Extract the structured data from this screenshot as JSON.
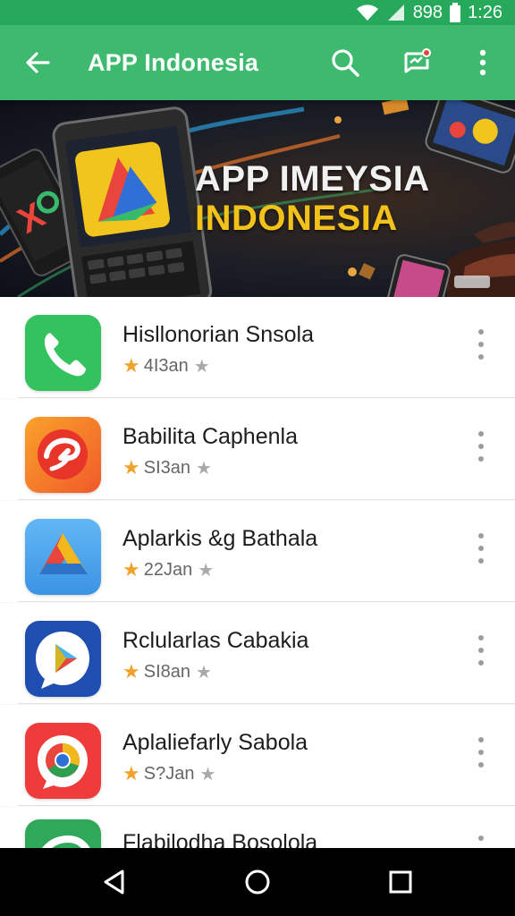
{
  "status_bar": {
    "signal_text": "898",
    "time": "1:26"
  },
  "app_bar": {
    "title": "APP Indonesia",
    "back_icon": "arrow-back-icon",
    "search_icon": "search-icon",
    "notification_icon": "notification-badge-icon",
    "menu_icon": "more-vert-icon"
  },
  "banner": {
    "line1": "APP IMEYSIA",
    "line2": "INDONESIA"
  },
  "apps": [
    {
      "name": "Hisllonorian Snsola",
      "rating": "4I3an",
      "icon": "phone-icon",
      "color": "#35c35f"
    },
    {
      "name": "Babilita Caphenla",
      "rating": "SI3an",
      "icon": "swirl-icon",
      "color": "#f4802a"
    },
    {
      "name": "Aplarkis &g Bathala",
      "rating": "22Jan",
      "icon": "triangle-logo-icon",
      "color": "#4ea7ef"
    },
    {
      "name": "Rclularlas Cabakia",
      "rating": "SI8an",
      "icon": "play-chat-icon",
      "color": "#1e4fb0"
    },
    {
      "name": "Aplaliefarly Sabola",
      "rating": "S?Jan",
      "icon": "circle-logo-icon",
      "color": "#ef3b3b"
    },
    {
      "name": "Flabilodha Bosolola",
      "rating": "",
      "icon": "partial-app-icon",
      "color": "#2fa85a"
    }
  ],
  "nav": {
    "back": "nav-back-icon",
    "home": "nav-home-icon",
    "recents": "nav-recents-icon"
  }
}
